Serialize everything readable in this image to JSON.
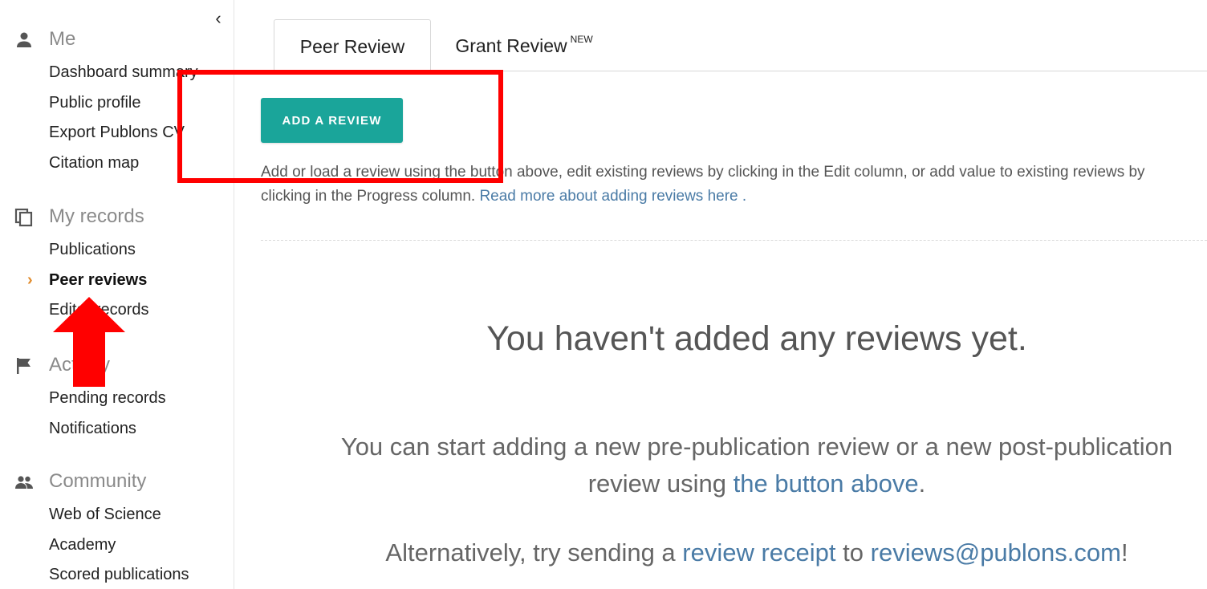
{
  "sidebar": {
    "collapse_icon": "chevron-left-icon",
    "sections": [
      {
        "id": "me",
        "label": "Me",
        "icon": "person-icon",
        "items": [
          {
            "label": "Dashboard summary"
          },
          {
            "label": "Public profile"
          },
          {
            "label": "Export Publons CV"
          },
          {
            "label": "Citation map"
          }
        ]
      },
      {
        "id": "my-records",
        "label": "My records",
        "icon": "copy-icon",
        "items": [
          {
            "label": "Publications"
          },
          {
            "label": "Peer reviews",
            "active": true
          },
          {
            "label": "Editor records"
          }
        ]
      },
      {
        "id": "activity",
        "label": "Activity",
        "icon": "flag-icon",
        "items": [
          {
            "label": "Pending records"
          },
          {
            "label": "Notifications"
          }
        ]
      },
      {
        "id": "community",
        "label": "Community",
        "icon": "people-icon",
        "items": [
          {
            "label": "Web of Science"
          },
          {
            "label": "Academy"
          },
          {
            "label": "Scored publications"
          }
        ]
      }
    ]
  },
  "tabs": [
    {
      "label": "Peer Review",
      "active": true
    },
    {
      "label": "Grant Review",
      "badge": "NEW"
    }
  ],
  "main": {
    "add_button": "ADD A REVIEW",
    "help_text": "Add or load a review using the button above, edit existing reviews by clicking in the Edit column, or add value to existing reviews by clicking in the Progress column. ",
    "help_link": "Read more about adding reviews here .",
    "empty_title": "You haven't added any reviews yet.",
    "empty_body_prefix": "You can start adding a new pre-publication review or a new post-publication review using ",
    "empty_body_link": "the button above",
    "empty_body_suffix": ".",
    "alt_prefix": "Alternatively, try sending a ",
    "alt_link_receipt": "review receipt",
    "alt_middle": " to ",
    "alt_link_email": "reviews@publons.com",
    "alt_suffix": "!"
  },
  "colors": {
    "accent": "#1aa59a",
    "link": "#4a7ba6",
    "active_chevron": "#e08a2a",
    "annotation": "#ff0000"
  }
}
